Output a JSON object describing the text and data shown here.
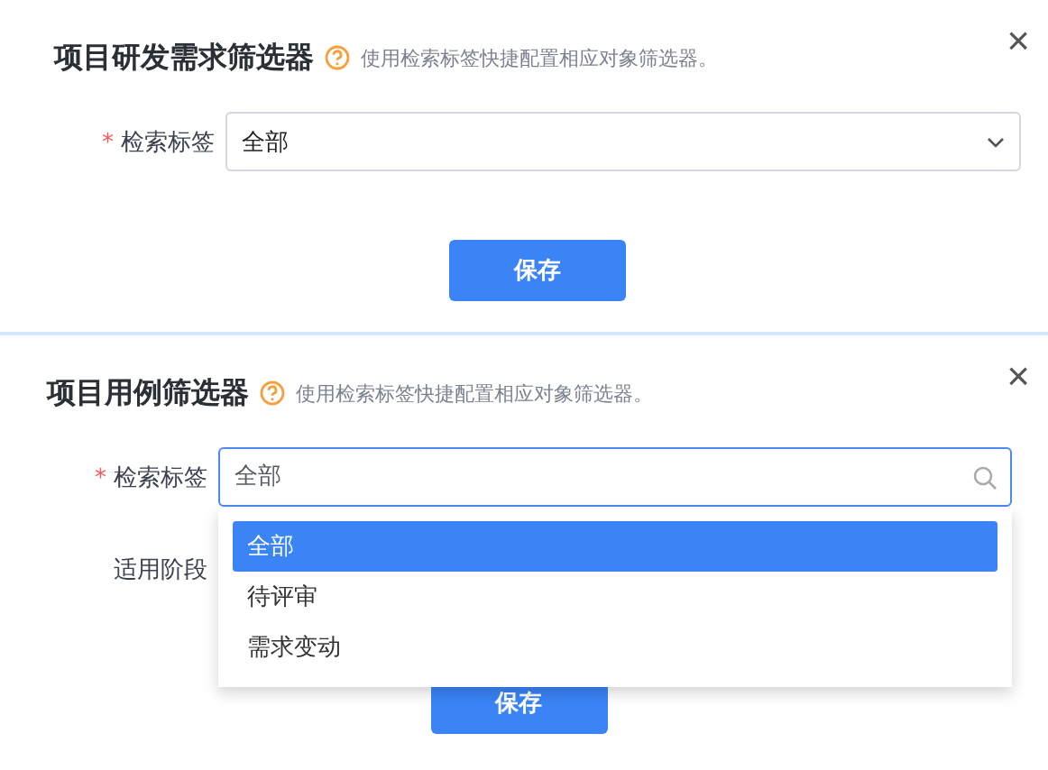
{
  "dialogs": [
    {
      "title": "项目研发需求筛选器",
      "hint": "使用检索标签快捷配置相应对象筛选器。",
      "close": "×",
      "fields": [
        {
          "label": "检索标签",
          "required_mark": "*",
          "kind": "select",
          "value": "全部",
          "focused": false
        }
      ],
      "save": "保存"
    },
    {
      "title": "项目用例筛选器",
      "hint": "使用检索标签快捷配置相应对象筛选器。",
      "close": "×",
      "fields": [
        {
          "label": "检索标签",
          "required_mark": "*",
          "kind": "search",
          "placeholder": "全部",
          "focused": true,
          "options": [
            {
              "label": "全部",
              "selected": true
            },
            {
              "label": "待评审",
              "selected": false
            },
            {
              "label": "需求变动",
              "selected": false
            }
          ]
        },
        {
          "label": "适用阶段",
          "kind": "hidden"
        }
      ],
      "save": "保存"
    }
  ]
}
